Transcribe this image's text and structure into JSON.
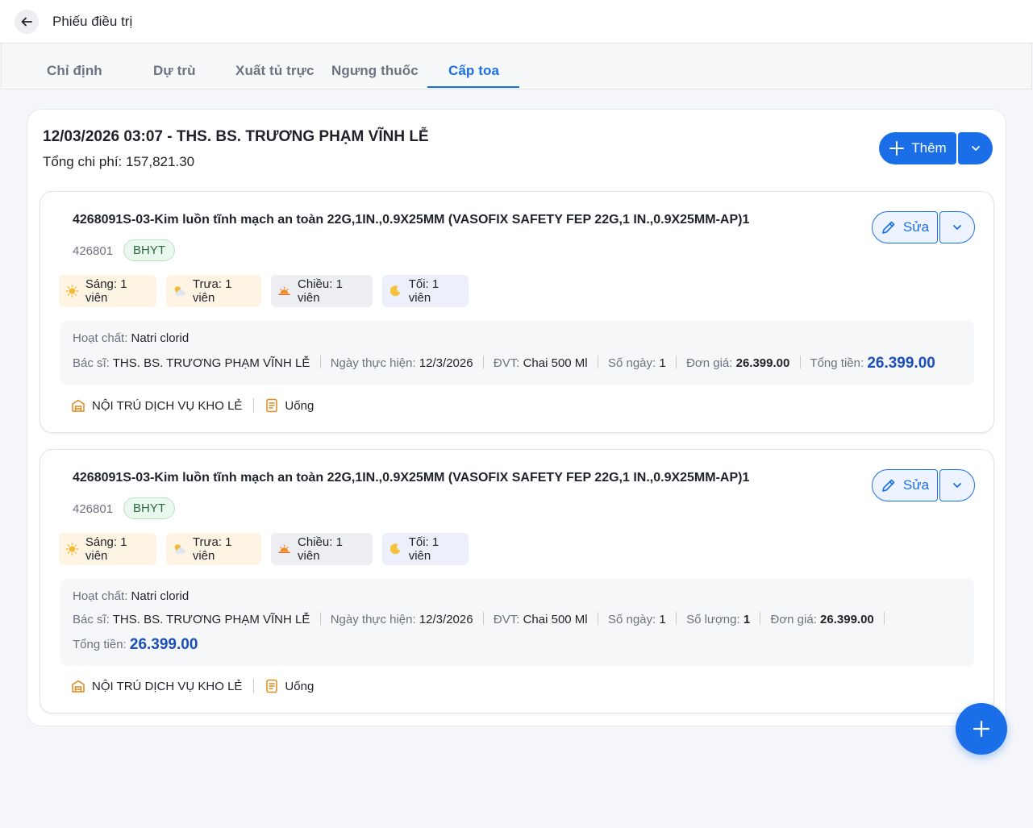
{
  "header": {
    "title": "Phiếu điều trị"
  },
  "tabs": [
    {
      "label": "Chỉ định"
    },
    {
      "label": "Dự trù"
    },
    {
      "label": "Xuất tủ trực"
    },
    {
      "label": "Ngưng thuốc"
    },
    {
      "label": "Cấp toa"
    }
  ],
  "active_tab": "Cấp toa",
  "panel": {
    "title": "12/03/2026 03:07 - THS. BS. TRƯƠNG PHẠM VĨNH LỄ",
    "cost_label": "Tổng chi phí:",
    "cost_value": "157,821.30",
    "add_label": "Thêm"
  },
  "labels": {
    "edit": "Sửa",
    "active_ingredient": "Hoạt chất:",
    "doctor": "Bác sĩ:",
    "date": "Ngày thực hiện:",
    "unit": "ĐVT:",
    "days": "Số ngày:",
    "quantity": "Số lượng:",
    "unit_price": "Đơn giá:",
    "total": "Tổng tiền:"
  },
  "cards": [
    {
      "name": "4268091S-03-Kim luồn tĩnh mạch an toàn 22G,1IN.,0.9X25MM (VASOFIX SAFETY FEP 22G,1 IN.,0.9X25MM-AP)1",
      "code": "426801",
      "badge": "BHYT",
      "doses": {
        "morning": "Sáng: 1 viên",
        "noon": "Trưa: 1 viên",
        "afternoon": "Chiều: 1 viên",
        "night": "Tối: 1 viên"
      },
      "active_ingredient": "Natri clorid",
      "doctor": "THS. BS. TRƯƠNG PHẠM VĨNH LỄ",
      "date": "12/3/2026",
      "unit": "Chai 500 Ml",
      "days": "1",
      "unit_price": "26.399.00",
      "total": "26.399.00",
      "warehouse": "NỘI TRÚ DỊCH VỤ KHO LẺ",
      "route": "Uống"
    },
    {
      "name": "4268091S-03-Kim luồn tĩnh mạch an toàn 22G,1IN.,0.9X25MM (VASOFIX SAFETY FEP 22G,1 IN.,0.9X25MM-AP)1",
      "code": "426801",
      "badge": "BHYT",
      "doses": {
        "morning": "Sáng: 1 viên",
        "noon": "Trưa: 1 viên",
        "afternoon": "Chiều: 1 viên",
        "night": "Tối: 1 viên"
      },
      "active_ingredient": "Natri clorid",
      "doctor": "THS. BS. TRƯƠNG PHẠM VĨNH LỄ",
      "date": "12/3/2026",
      "unit": "Chai 500 Ml",
      "days": "1",
      "quantity": "1",
      "unit_price": "26.399.00",
      "total": "26.399.00",
      "warehouse": "NỘI TRÚ DỊCH VỤ KHO LẺ",
      "route": "Uống"
    }
  ],
  "icons": {
    "back": "arrow-left-icon",
    "add": "plus-icon",
    "dropdown": "chevron-down-icon",
    "edit": "pencil-icon",
    "morning": "sun-icon",
    "noon": "sun-cloud-icon",
    "afternoon": "sunset-icon",
    "night": "moon-icon",
    "warehouse": "warehouse-icon",
    "route": "document-icon",
    "fab": "plus-icon"
  },
  "colors": {
    "primary": "#1a6fe8",
    "total_text": "#1a4fb8",
    "badge_bg": "#eaf7ee",
    "warehouse_icon": "#e08a1e"
  }
}
